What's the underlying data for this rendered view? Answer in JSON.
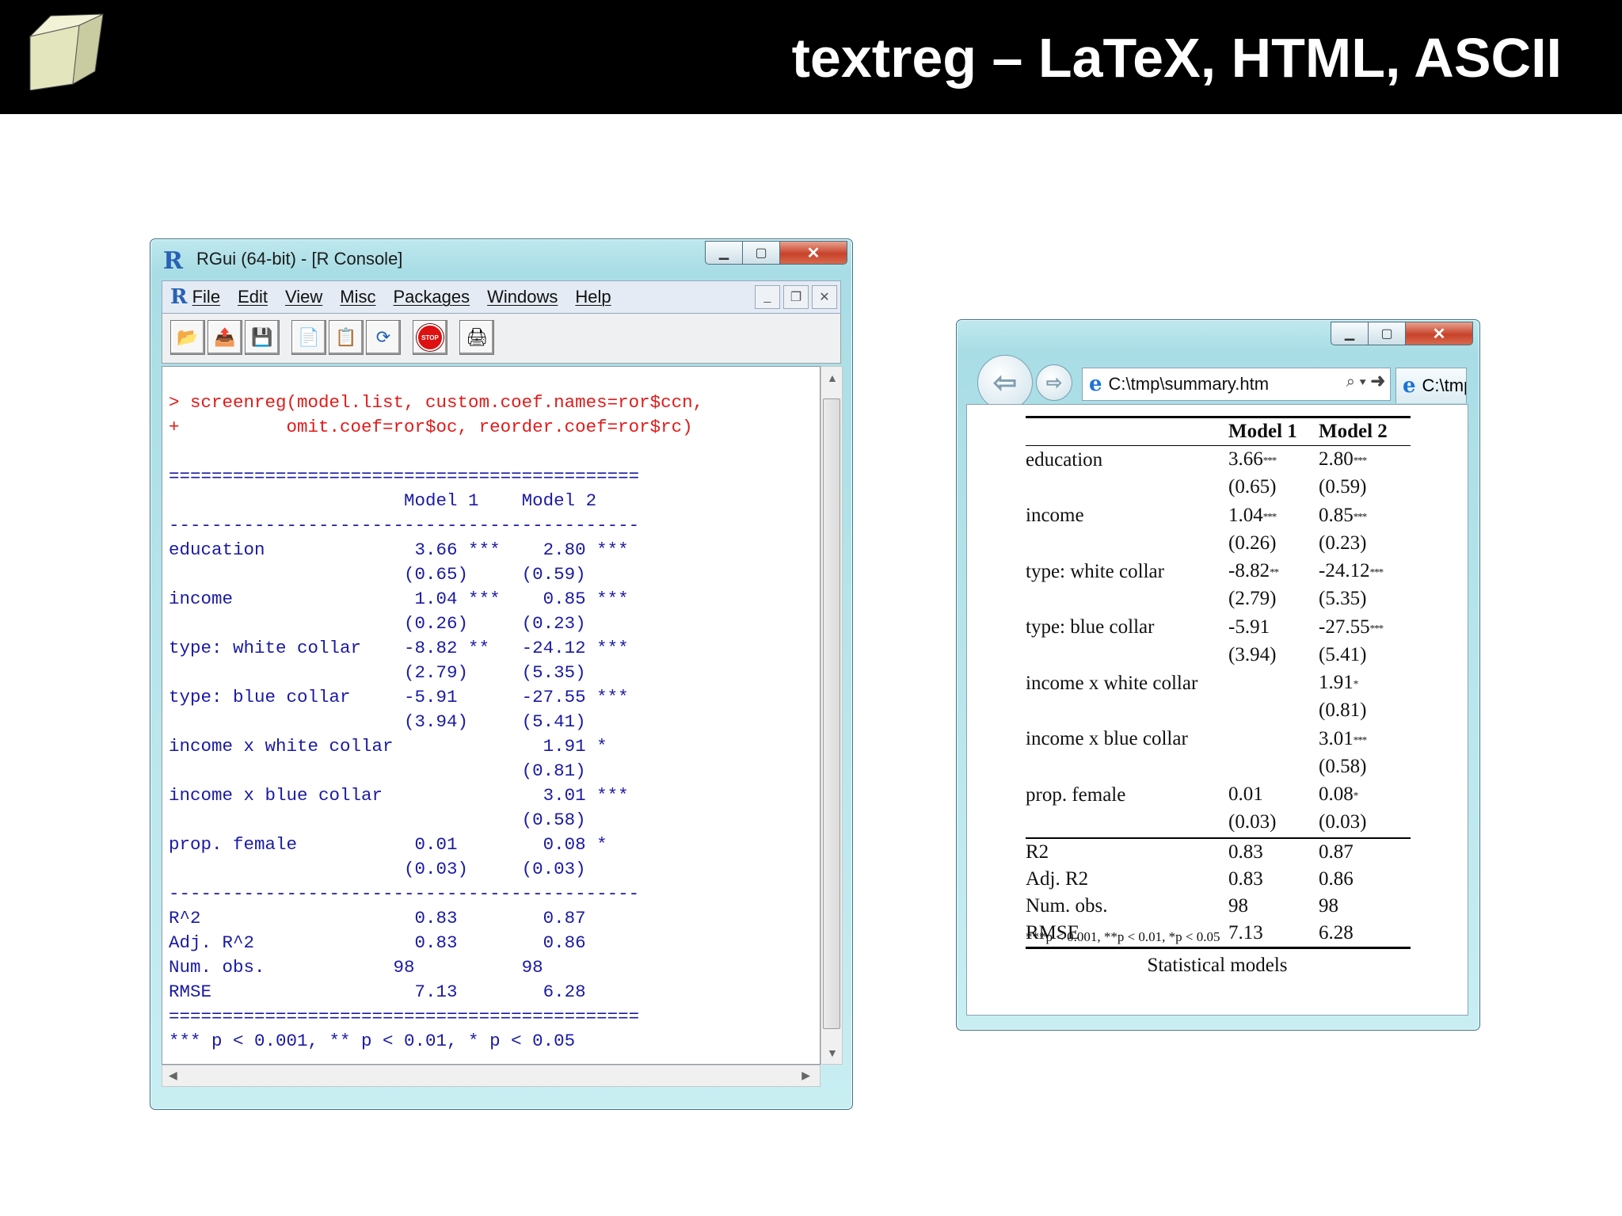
{
  "slide": {
    "title": "textreg – LaTeX, HTML, ASCII"
  },
  "rgui": {
    "window_title": "RGui (64-bit) - [R Console]",
    "menu": [
      "File",
      "Edit",
      "View",
      "Misc",
      "Packages",
      "Windows",
      "Help"
    ],
    "toolbar_icons": [
      "open-script-icon",
      "load-workspace-icon",
      "save-icon",
      "copy-icon",
      "paste-icon",
      "refresh-icon",
      "stop-icon",
      "print-icon"
    ],
    "stop_label": "STOP",
    "command": [
      "> screenreg(model.list, custom.coef.names=ror$ccn,",
      "+          omit.coef=ror$oc, reorder.coef=ror$rc)"
    ],
    "output": [
      "",
      "============================================",
      "                      Model 1    Model 2    ",
      "--------------------------------------------",
      "education              3.66 ***    2.80 ***",
      "                      (0.65)     (0.59)    ",
      "income                 1.04 ***    0.85 ***",
      "                      (0.26)     (0.23)    ",
      "type: white collar    -8.82 **   -24.12 ***",
      "                      (2.79)     (5.35)    ",
      "type: blue collar     -5.91      -27.55 ***",
      "                      (3.94)     (5.41)    ",
      "income x white collar              1.91 *  ",
      "                                 (0.81)    ",
      "income x blue collar               3.01 ***",
      "                                 (0.58)    ",
      "prop. female           0.01        0.08 *  ",
      "                      (0.03)     (0.03)    ",
      "--------------------------------------------",
      "R^2                    0.83        0.87    ",
      "Adj. R^2               0.83        0.86    ",
      "Num. obs.            98          98        ",
      "RMSE                   7.13        6.28    ",
      "============================================",
      "*** p < 0.001, ** p < 0.01, * p < 0.05"
    ]
  },
  "browser": {
    "address": "C:\\tmp\\summary.htm",
    "tab_label": "C:\\tmp",
    "table": {
      "headers": [
        "",
        "Model 1",
        "Model 2"
      ],
      "rows": [
        {
          "label": "education",
          "m1": "3.66",
          "m1_stars": "***",
          "m2": "2.80",
          "m2_stars": "***"
        },
        {
          "label": "",
          "m1": "(0.65)",
          "m1_stars": "",
          "m2": "(0.59)",
          "m2_stars": ""
        },
        {
          "label": "income",
          "m1": "1.04",
          "m1_stars": "***",
          "m2": "0.85",
          "m2_stars": "***"
        },
        {
          "label": "",
          "m1": "(0.26)",
          "m1_stars": "",
          "m2": "(0.23)",
          "m2_stars": ""
        },
        {
          "label": "type: white collar",
          "m1": "-8.82",
          "m1_stars": "**",
          "m2": "-24.12",
          "m2_stars": "***"
        },
        {
          "label": "",
          "m1": "(2.79)",
          "m1_stars": "",
          "m2": "(5.35)",
          "m2_stars": ""
        },
        {
          "label": "type: blue collar",
          "m1": "-5.91",
          "m1_stars": "",
          "m2": "-27.55",
          "m2_stars": "***"
        },
        {
          "label": "",
          "m1": "(3.94)",
          "m1_stars": "",
          "m2": "(5.41)",
          "m2_stars": ""
        },
        {
          "label": "income x white collar",
          "m1": "",
          "m1_stars": "",
          "m2": "1.91",
          "m2_stars": "*"
        },
        {
          "label": "",
          "m1": "",
          "m1_stars": "",
          "m2": "(0.81)",
          "m2_stars": ""
        },
        {
          "label": "income x blue collar",
          "m1": "",
          "m1_stars": "",
          "m2": "3.01",
          "m2_stars": "***"
        },
        {
          "label": "",
          "m1": "",
          "m1_stars": "",
          "m2": "(0.58)",
          "m2_stars": ""
        },
        {
          "label": "prop. female",
          "m1": "0.01",
          "m1_stars": "",
          "m2": "0.08",
          "m2_stars": "*"
        },
        {
          "label": "",
          "m1": "(0.03)",
          "m1_stars": "",
          "m2": "(0.03)",
          "m2_stars": ""
        }
      ],
      "gof": [
        {
          "label": "R2",
          "m1": "0.83",
          "m2": "0.87"
        },
        {
          "label": "Adj. R2",
          "m1": "0.83",
          "m2": "0.86"
        },
        {
          "label": "Num. obs.",
          "m1": "98",
          "m2": "98"
        },
        {
          "label": "RMSE",
          "m1": "7.13",
          "m2": "6.28"
        }
      ],
      "note": "***p < 0.001, **p < 0.01, *p < 0.05",
      "caption": "Statistical models"
    }
  }
}
